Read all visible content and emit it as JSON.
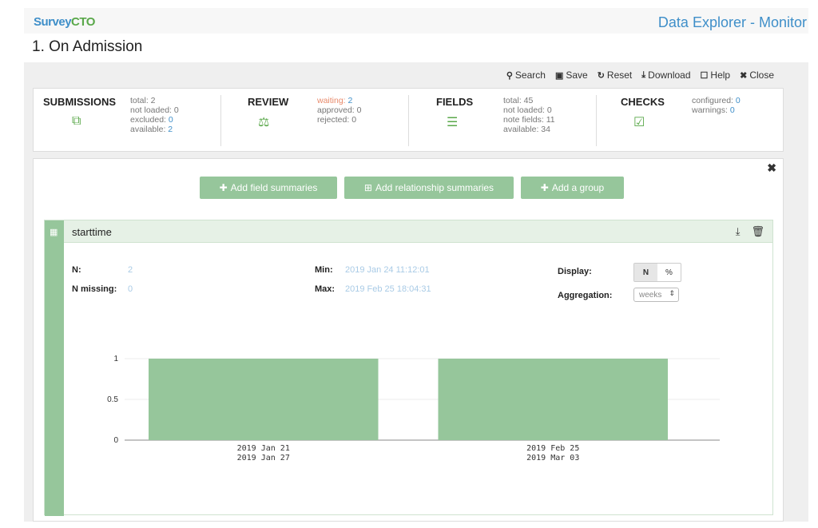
{
  "header": {
    "logo_part1": "Survey",
    "logo_part2": "CTO",
    "app_title": "Data Explorer - Monitor"
  },
  "page": {
    "title": "1. On Admission"
  },
  "toolbar": {
    "search": "Search",
    "save": "Save",
    "reset": "Reset",
    "download": "Download",
    "help": "Help",
    "close": "Close"
  },
  "stats": {
    "submissions": {
      "label": "SUBMISSIONS",
      "total_label": "total: 2",
      "not_loaded_label": "not loaded: 0",
      "excluded_label": "excluded: ",
      "excluded": "0",
      "available_label": "available: ",
      "available": "2"
    },
    "review": {
      "label": "REVIEW",
      "waiting_label": "waiting: ",
      "waiting": "2",
      "approved_label": "approved: 0",
      "rejected_label": "rejected: 0"
    },
    "fields": {
      "label": "FIELDS",
      "total_label": "total: 45",
      "not_loaded_label": "not loaded: 0",
      "note_fields_label": "note fields: 11",
      "available_label": "available: 34"
    },
    "checks": {
      "label": "CHECKS",
      "configured_label": "configured: ",
      "configured": "0",
      "warnings_label": "warnings: ",
      "warnings": "0"
    }
  },
  "actions": {
    "add_field": "Add field summaries",
    "add_relationship": "Add relationship summaries",
    "add_group": "Add a group"
  },
  "card": {
    "title": "starttime",
    "n_label": "N:",
    "n_value": "2",
    "n_missing_label": "N missing:",
    "n_missing_value": "0",
    "min_label": "Min:",
    "min_value": "2019 Jan 24 11:12:01",
    "max_label": "Max:",
    "max_value": "2019 Feb 25 18:04:31",
    "display_label": "Display:",
    "display_n": "N",
    "display_pct": "%",
    "aggregation_label": "Aggregation:",
    "aggregation_value": "weeks"
  },
  "chart_data": {
    "type": "bar",
    "categories": [
      [
        "2019 Jan 21",
        "2019 Jan 27"
      ],
      [
        "2019 Feb 25",
        "2019 Mar 03"
      ]
    ],
    "values": [
      1,
      1
    ],
    "yticks": [
      "0",
      "0.5",
      "1"
    ],
    "ylim": [
      0,
      1
    ],
    "color": "#96c69b"
  }
}
